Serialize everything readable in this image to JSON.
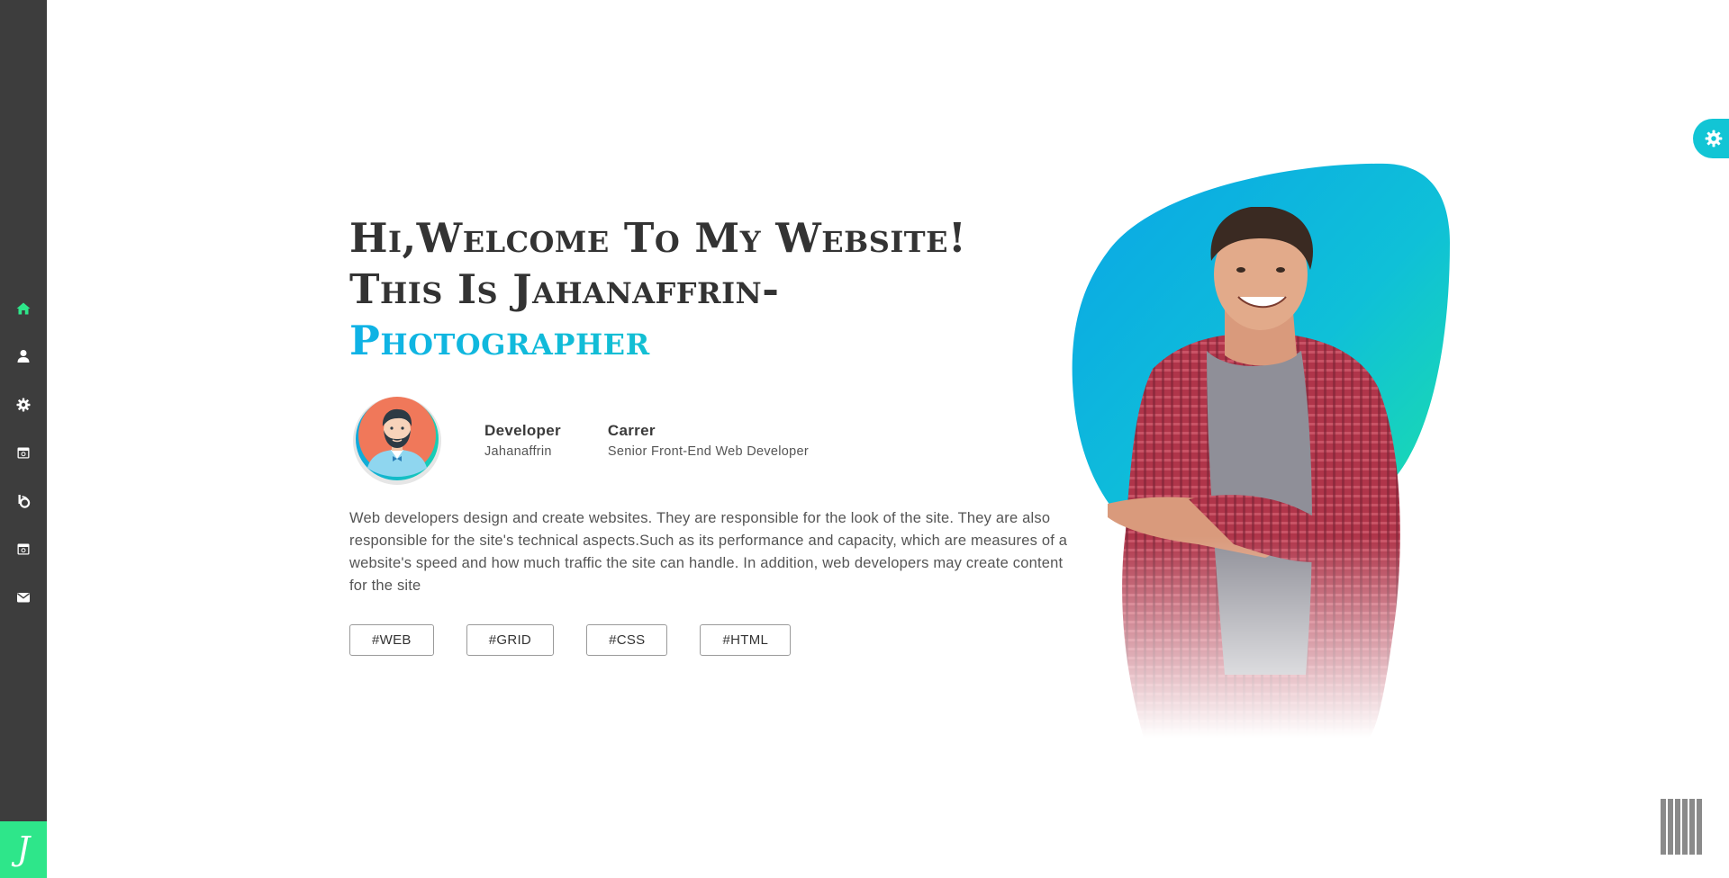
{
  "sidebar": {
    "nav": [
      {
        "name": "home",
        "icon": "home-icon",
        "active": true
      },
      {
        "name": "about",
        "icon": "user-icon",
        "active": false
      },
      {
        "name": "services",
        "icon": "gear-icon",
        "active": false
      },
      {
        "name": "portfolio",
        "icon": "calendar-icon",
        "active": false
      },
      {
        "name": "blog",
        "icon": "blog-icon",
        "active": false
      },
      {
        "name": "news",
        "icon": "calendar-icon",
        "active": false
      },
      {
        "name": "contact",
        "icon": "envelope-icon",
        "active": false
      }
    ],
    "brand_letter": "J",
    "active_color": "#2ee68a",
    "icon_color": "#ffffff"
  },
  "hero": {
    "line1": "Hi,Welcome To My Website!",
    "line2": "This Is Jahanaffrin-",
    "line3": "Photographer"
  },
  "info": {
    "role_title": "Developer",
    "role_value": "Jahanaffrin",
    "career_title": "Carrer",
    "career_value": "Senior Front-End Web Developer"
  },
  "description": "Web developers design and create websites. They are responsible for the look of the site. They are also responsible for the site's technical aspects.Such as its performance and capacity, which are measures of a website's speed and how much traffic the site can handle. In addition, web developers may create content for the site",
  "tags": [
    "#WEB",
    "#GRID",
    "#CSS",
    "#HTML"
  ],
  "settings": {
    "icon": "gear-icon",
    "color": "#12c5d5"
  },
  "colors": {
    "accent_start": "#0fb2e6",
    "accent_end": "#17d1b8",
    "sidebar_bg": "#3d3d3d"
  }
}
